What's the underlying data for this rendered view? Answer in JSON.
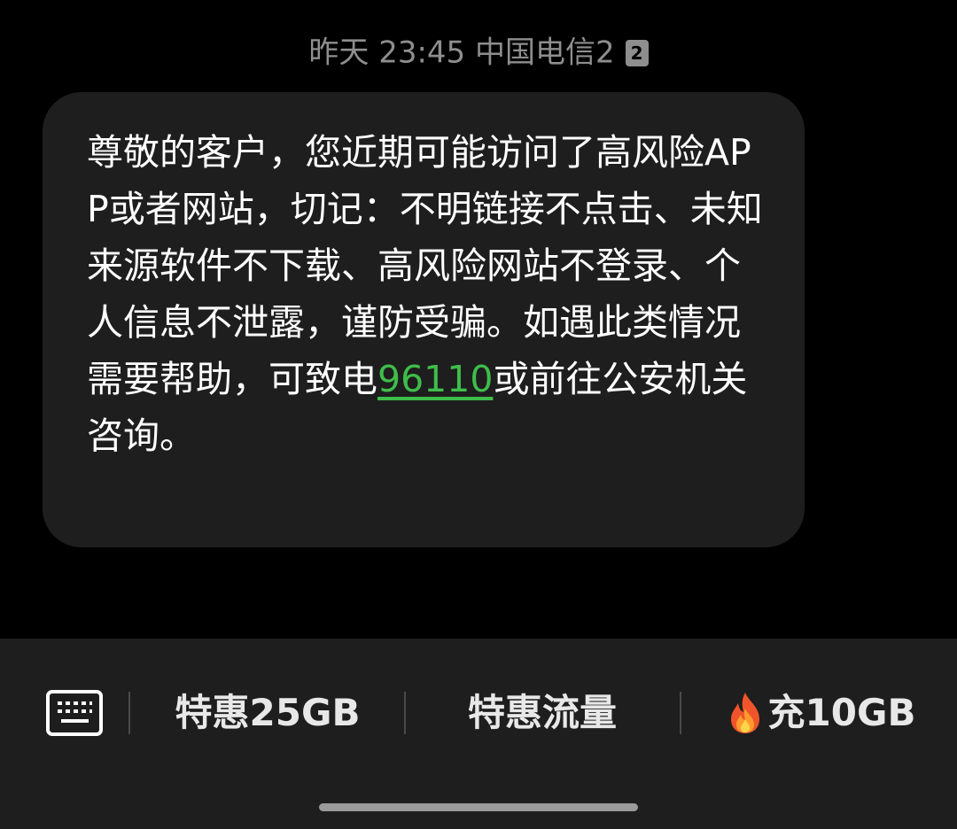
{
  "message_meta": {
    "day": "昨天",
    "time": "23:45",
    "carrier": "中国电信2",
    "sim_slot": "2"
  },
  "message": {
    "text_before_link": "尊敬的客户，您近期可能访问了高风险APP或者网站，切记：不明链接不点击、未知来源软件不下载、高风险网站不登录、个人信息不泄露，谨防受骗。如遇此类情况需要帮助，可致电",
    "link_number": "96110",
    "text_after_link": "或前往公安机关咨询。"
  },
  "quick_bar": {
    "keyboard_icon": "keyboard-icon",
    "items": [
      {
        "label": "特惠25GB"
      },
      {
        "label": "特惠流量"
      },
      {
        "label": "充10GB",
        "icon": "fire-icon"
      }
    ]
  },
  "colors": {
    "background": "#000000",
    "bubble": "#1e1e1e",
    "link": "#3ebd4a",
    "meta_text": "#8e8e8e"
  }
}
